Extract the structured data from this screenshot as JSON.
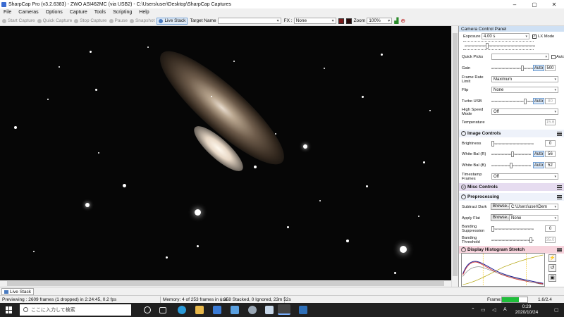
{
  "window": {
    "title": "SharpCap Pro (v3.2.6383) - ZWO ASI462MC (via USB2) - C:\\Users\\user\\Desktop\\SharpCap Captures",
    "minimize": "–",
    "maximize": "▢",
    "close": "✕"
  },
  "menu": [
    "File",
    "Cameras",
    "Options",
    "Capture",
    "Tools",
    "Scripting",
    "Help"
  ],
  "toolbar": {
    "start_capture": "Start Capture",
    "quick_capture": "Quick Capture",
    "stop_capture": "Stop Capture",
    "pause": "Pause",
    "snapshot": "Snapshot",
    "live_stack": "Live Stack",
    "target_name_label": "Target Name",
    "target_name_value": "",
    "fx_label": "FX :",
    "fx_value": "None",
    "zoom_label": "Zoom",
    "zoom_value": "100%"
  },
  "panel": {
    "header": "Camera Control Panel",
    "exposure_label": "Exposure",
    "exposure_value": "4.00 s",
    "lx_mode": "LX Mode",
    "quick_picks": "Quick Picks",
    "auto": "Auto",
    "gain_label": "Gain",
    "gain_value": "500",
    "frame_rate_label": "Frame Rate Limit",
    "frame_rate_value": "Maximum",
    "flip_label": "Flip",
    "flip_value": "None",
    "turbo_label": "Turbo USB",
    "turbo_value": "80",
    "high_speed_label": "High Speed Mode",
    "high_speed_value": "Off",
    "temperature_label": "Temperature",
    "temperature_value": "15.6",
    "image_controls": "Image Controls",
    "brightness_label": "Brightness",
    "brightness_value": "0",
    "wb_r_label": "White Bal (R)",
    "wb_r_value": "56",
    "wb_b_label": "White Bal (B)",
    "wb_b_value": "52",
    "timestamp_label": "Timestamp Frames",
    "timestamp_value": "Off",
    "misc_controls": "Misc Controls",
    "preprocessing": "Preprocessing",
    "subtract_dark_label": "Subtract Dark",
    "browse": "Browse...",
    "subtract_dark_value": "C:\\Users\\user\\Dem",
    "apply_flat_label": "Apply Flat",
    "apply_flat_value": "None",
    "banding_supp_label": "Banding Suppression",
    "banding_supp_value": "0",
    "banding_thresh_label": "Banding Threshold",
    "banding_thresh_value": "35.0",
    "histogram": "Display Histogram Stretch"
  },
  "bottom_tab": "Live Stack",
  "status": {
    "preview": "Previewing : 2609 frames (1 dropped) in 2:24:45, 0.2 fps",
    "memory": "Memory: 4 of 253 frames in use.",
    "stacked": "358 Stacked, 0 Ignored, 23m 52s",
    "frame_label": "Frame:",
    "frame_value": "1.6/2.4"
  },
  "taskbar": {
    "search_placeholder": "ここに入力して検索",
    "time": "0:29",
    "date": "2020/10/24",
    "ime": "A"
  },
  "colors": {
    "histogram_header_bg": "#f6d3dc",
    "misc_header_bg": "#e6dcf0",
    "panel_header_bg": "#cfe0f3",
    "frame_bar": "#1fbf3a"
  }
}
